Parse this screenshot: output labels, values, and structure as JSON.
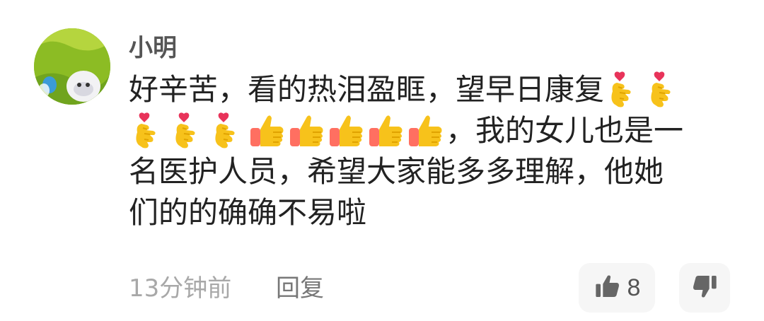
{
  "comment": {
    "username": "小明",
    "lines": [
      [
        {
          "t": "text",
          "v": "好辛苦，看的热泪盈眶，望早日康复"
        },
        {
          "t": "emoji",
          "icon": "finger-heart-emoji"
        },
        {
          "t": "emoji",
          "icon": "finger-heart-emoji"
        }
      ],
      [
        {
          "t": "emoji",
          "icon": "finger-heart-emoji"
        },
        {
          "t": "emoji",
          "icon": "finger-heart-emoji"
        },
        {
          "t": "emoji",
          "icon": "finger-heart-emoji"
        },
        {
          "t": "emoji",
          "icon": "thumbs-up-emoji"
        },
        {
          "t": "emoji",
          "icon": "thumbs-up-emoji"
        },
        {
          "t": "emoji",
          "icon": "thumbs-up-emoji"
        },
        {
          "t": "emoji",
          "icon": "thumbs-up-emoji"
        },
        {
          "t": "emoji",
          "icon": "thumbs-up-emoji"
        },
        {
          "t": "text",
          "v": "，我的女儿也是一"
        }
      ],
      [
        {
          "t": "text",
          "v": "名医护人员，希望大家能多多理解，他她"
        }
      ],
      [
        {
          "t": "text",
          "v": "们的的确确不易啦"
        }
      ]
    ],
    "time": "13分钟前",
    "reply_label": "回复",
    "like_count": "8"
  },
  "icons": {
    "avatar": "cartoon-yeti-avatar",
    "like": "thumbs-up-icon",
    "dislike": "thumbs-down-icon"
  },
  "colors": {
    "username": "#555555",
    "body_text": "#222222",
    "meta_text": "#a8a8a8",
    "button_bg": "#f6f6f6",
    "emoji_yellow": "#f7c21b",
    "emoji_heart": "#e8335a",
    "emoji_sleeve": "#ff6f61"
  }
}
